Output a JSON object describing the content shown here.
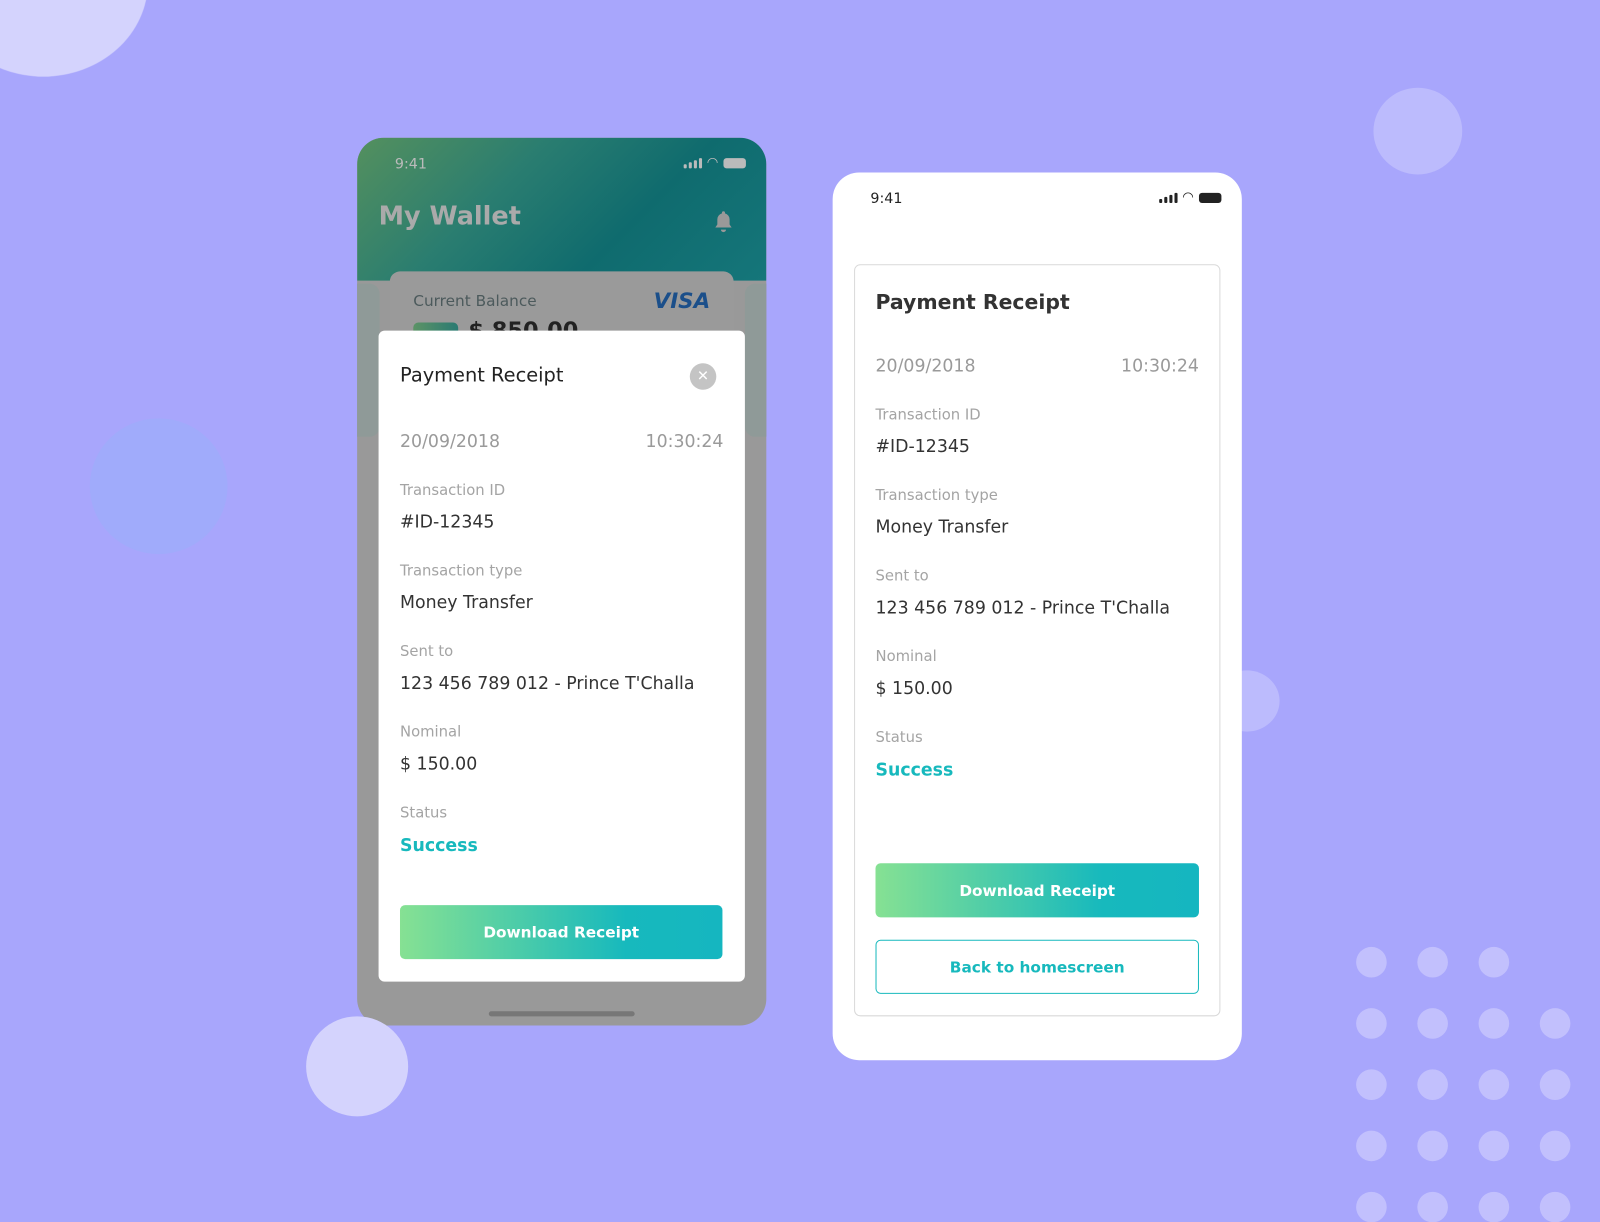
{
  "left_phone": {
    "status_time": "9:41",
    "header_title": "My Wallet",
    "card": {
      "label": "Current Balance",
      "brand": "VISA",
      "amount": "$ 850.00"
    },
    "modal": {
      "title": "Payment Receipt",
      "date": "20/09/2018",
      "time": "10:30:24",
      "fields": [
        {
          "label": "Transaction ID",
          "value": "#ID-12345"
        },
        {
          "label": "Transaction type",
          "value": "Money Transfer"
        },
        {
          "label": "Sent to",
          "value": "123 456 789 012 - Prince T'Challa"
        },
        {
          "label": "Nominal",
          "value": "$ 150.00"
        },
        {
          "label": "Status",
          "value": "Success"
        }
      ],
      "download_label": "Download Receipt"
    }
  },
  "right_phone": {
    "status_time": "9:41",
    "receipt": {
      "title": "Payment Receipt",
      "date": "20/09/2018",
      "time": "10:30:24",
      "fields": [
        {
          "label": "Transaction ID",
          "value": "#ID-12345"
        },
        {
          "label": "Transaction type",
          "value": "Money Transfer"
        },
        {
          "label": "Sent to",
          "value": "123 456 789 012 - Prince T'Challa"
        },
        {
          "label": "Nominal",
          "value": "$ 150.00"
        },
        {
          "label": "Status",
          "value": "Success"
        }
      ],
      "download_label": "Download Receipt",
      "back_label": "Back to homescreen"
    }
  },
  "colors": {
    "background": "#a8a6fc",
    "accent": "#17b9bd",
    "gradient_start": "#86e193"
  }
}
